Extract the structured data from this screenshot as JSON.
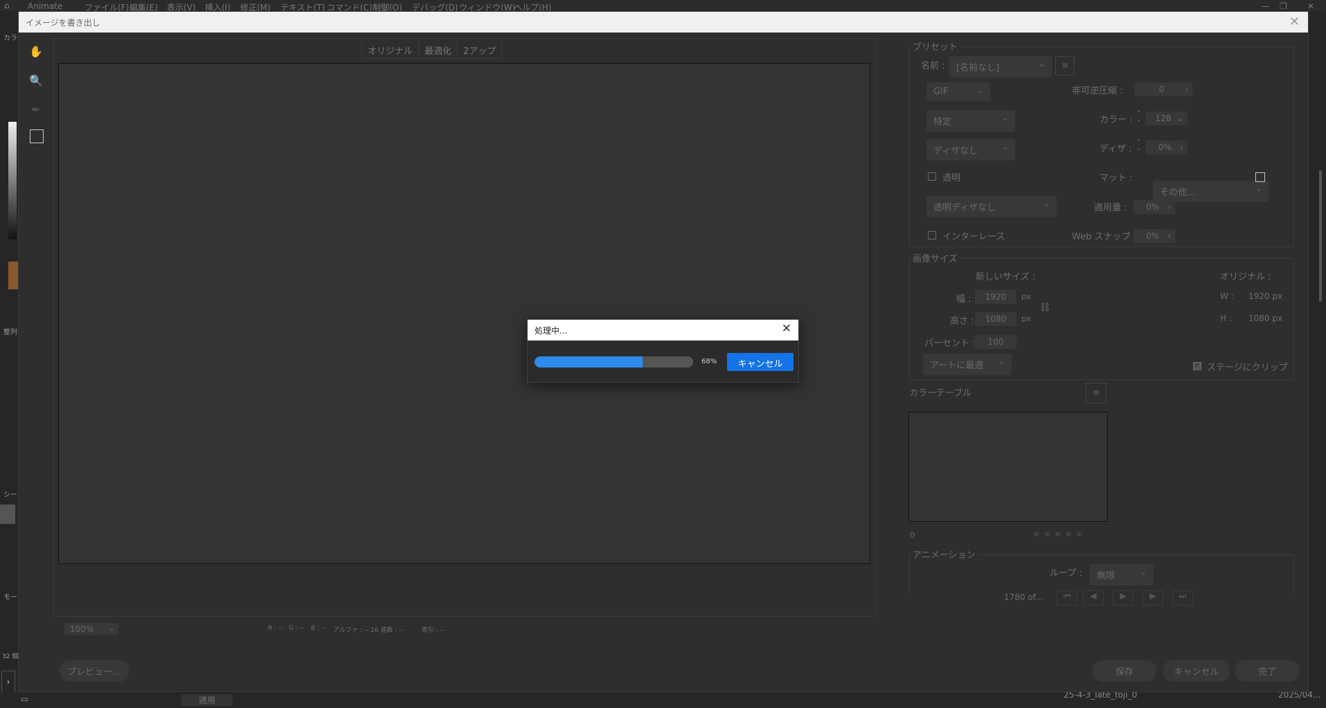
{
  "menubar": {
    "app_name": "Animate",
    "items": [
      "ファイル(F)",
      "編集(E)",
      "表示(V)",
      "挿入(I)",
      "修正(M)",
      "テキスト(T)",
      "コマンド(C)",
      "制御(O)",
      "デバッグ(D)",
      "ウィンドウ(W)",
      "ヘルプ(H)"
    ]
  },
  "background": {
    "left_labels": [
      "カラー",
      "整列",
      "シー",
      "モー",
      "32 個"
    ],
    "bottom_apply": "適用",
    "bottom_file": "25-4-3_late_toji_0",
    "bottom_date": "2025/04..."
  },
  "dialog": {
    "title": "イメージを書き出し",
    "tabs": [
      "オリジナル",
      "最適化",
      "2アップ"
    ],
    "zoom": "100%",
    "status": {
      "r": "R : --",
      "g": "G : --",
      "b": "B : --",
      "alpha": "アルファ : --",
      "hex": "16 進数 : --",
      "index": "索引 : --"
    },
    "preview_button": "プレビュー...",
    "save_button": "保存",
    "cancel_button": "キャンセル",
    "done_button": "完了"
  },
  "preset": {
    "legend": "プリセット",
    "name_label": "名前 :",
    "name_value": "[名前なし]",
    "format": "GIF",
    "palette": "特定",
    "dither_mode": "ディザなし",
    "transparency_label": "透明",
    "transparency_dither": "透明ディザなし",
    "interlace_label": "インターレース",
    "lossy_label": "非可逆圧縮 :",
    "lossy_value": "0",
    "colors_label": "カラー :",
    "colors_value": "128",
    "dither_label": "ディザ :",
    "dither_value": "0%",
    "matte_label": "マット :",
    "matte_value": "その他...",
    "amount_label": "適用量 :",
    "amount_value": "0%",
    "websnap_label": "Web スナップ :",
    "websnap_value": "0%"
  },
  "image_size": {
    "legend": "画像サイズ",
    "new_size_label": "新しいサイズ :",
    "original_label": "オリジナル :",
    "width_label": "幅 :",
    "width_value": "1920",
    "height_label": "高さ :",
    "height_value": "1080",
    "unit": "px",
    "percent_label": "パーセント :",
    "percent_value": "100",
    "fit_dropdown": "アートに最適",
    "orig_w_label": "W :",
    "orig_w_value": "1920 px",
    "orig_h_label": "H :",
    "orig_h_value": "1080 px",
    "clip_label": "ステージにクリップ"
  },
  "color_table": {
    "legend": "カラーテーブル",
    "count": "0"
  },
  "animation": {
    "legend": "アニメーション",
    "loop_label": "ループ :",
    "loop_value": "無限",
    "frame_label": "1780 of..."
  },
  "progress": {
    "title": "処理中...",
    "percent_text": "68%",
    "fraction": 0.68,
    "cancel_label": "キャンセル",
    "accent": "#1473e6"
  }
}
